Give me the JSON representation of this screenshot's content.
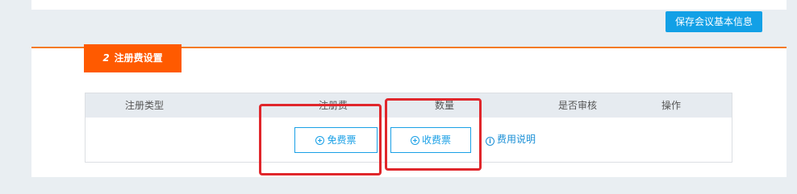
{
  "header": {
    "save_label": "保存会议基本信息"
  },
  "section": {
    "number": "2",
    "title": "注册费设置"
  },
  "table": {
    "columns": [
      "注册类型",
      "注册费",
      "数量",
      "是否审核",
      "操作"
    ]
  },
  "actions": {
    "free_ticket_label": "免费票",
    "paid_ticket_label": "收费票",
    "fee_info_label": "费用说明"
  },
  "colors": {
    "accent_orange": "#ff5a00",
    "primary_blue": "#12a0e6",
    "annotation_red": "#e0262b"
  }
}
